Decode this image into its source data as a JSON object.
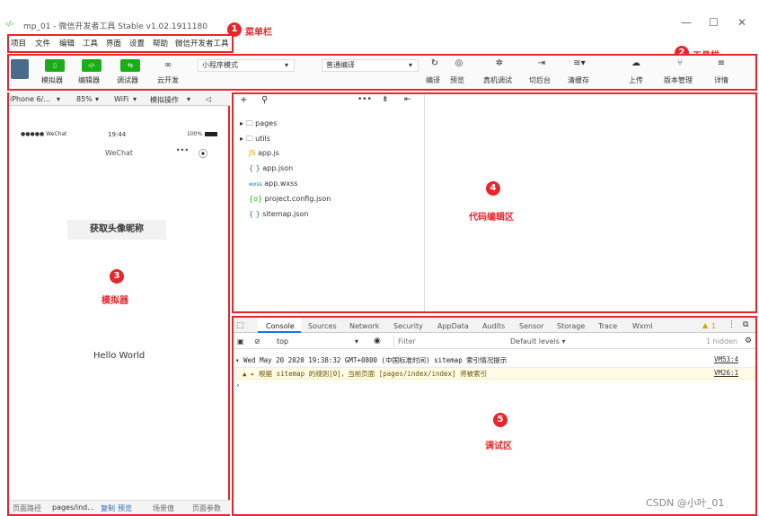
{
  "window": {
    "title": "mp_01 - 微信开发者工具 Stable v1.02.1911180",
    "controls": [
      "—",
      "☐",
      "✕"
    ]
  },
  "menubar": {
    "items": [
      "项目",
      "文件",
      "编辑",
      "工具",
      "界面",
      "设置",
      "帮助",
      "微信开发者工具"
    ]
  },
  "toolbar": {
    "simulator_label": "模拟器",
    "editor_label": "编辑器",
    "debugger_label": "调试器",
    "cloud_label": "云开发",
    "mode_select": "小程序模式",
    "compile_select": "普通编译",
    "compile_label": "编译",
    "preview_label": "预览",
    "real_debug_label": "真机调试",
    "background_label": "切后台",
    "clear_cache_label": "清缓存",
    "upload_label": "上传",
    "version_label": "版本管理",
    "details_label": "详情"
  },
  "simulator": {
    "device": "iPhone 6/...",
    "zoom": "85%",
    "network": "WiFi",
    "operation": "模拟操作",
    "status_carrier": "●●●●● WeChat",
    "status_time": "19:44",
    "status_battery": "100%",
    "nav_title": "WeChat",
    "button_label": "获取头像昵称",
    "hello": "Hello World",
    "footer_path_label": "页面路径",
    "footer_path": "pages/ind...",
    "footer_copy": "复制",
    "footer_preview": "预览",
    "footer_scene": "场景值",
    "footer_params": "页面参数"
  },
  "files": [
    {
      "name": "pages",
      "type": "folder"
    },
    {
      "name": "utils",
      "type": "folder"
    },
    {
      "name": "app.js",
      "type": "js",
      "icon": "JS"
    },
    {
      "name": "app.json",
      "type": "json",
      "icon": "{ }"
    },
    {
      "name": "app.wxss",
      "type": "wxss",
      "icon": "wxss"
    },
    {
      "name": "project.config.json",
      "type": "config",
      "icon": "{o}"
    },
    {
      "name": "sitemap.json",
      "type": "json",
      "icon": "{ }"
    }
  ],
  "debug": {
    "tabs": [
      "Console",
      "Sources",
      "Network",
      "Security",
      "AppData",
      "Audits",
      "Sensor",
      "Storage",
      "Trace",
      "Wxml"
    ],
    "warn_count": "1",
    "context": "top",
    "filter_placeholder": "Filter",
    "levels": "Default levels ▾",
    "hidden": "1 hidden",
    "log1_text": "▾ Wed May 20 2020 19:38:32 GMT+0800 (中国标准时间) sitemap 索引情况提示",
    "log1_link": "VM53:4",
    "log2_text": "▲ ▸ 根据 sitemap 的规则[0]，当前页面 [pages/index/index] 将被索引",
    "log2_link": "VM26:1",
    "prompt": "›"
  },
  "annotations": {
    "a1_num": "1",
    "a1_label": "菜单栏",
    "a2_num": "2",
    "a2_label": "工具栏",
    "a3_num": "3",
    "a3_label": "模拟器",
    "a4_num": "4",
    "a4_label": "代码编辑区",
    "a5_num": "5",
    "a5_label": "调试区"
  },
  "watermark": "CSDN @小叶_01",
  "colors": {
    "highlight": "#e8252a",
    "wechat_green": "#1aad19"
  }
}
